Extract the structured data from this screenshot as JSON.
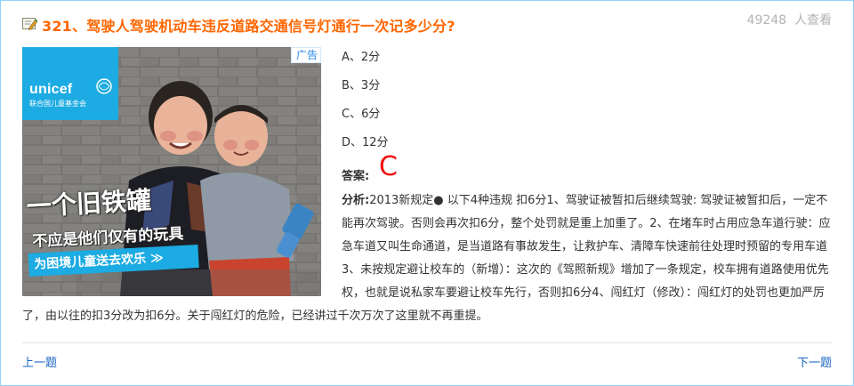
{
  "question": {
    "number_title": "321、驾驶人驾驶机动车违反道路交通信号灯通行一次记多少分?",
    "views_count": "49248",
    "views_suffix": "人查看",
    "icon": "edit-icon"
  },
  "ad": {
    "badge": "广告",
    "brand": "unicef",
    "brand_sub": "联合国儿童基金会",
    "headline": "一个旧铁罐",
    "subline": "不应是他们仅有的玩具",
    "cta": "为困境儿童送去欢乐 ≫"
  },
  "options": [
    {
      "label": "A、2分"
    },
    {
      "label": "B、3分"
    },
    {
      "label": "C、6分"
    },
    {
      "label": "D、12分"
    }
  ],
  "answer": {
    "label": "答案:",
    "value": "C",
    "color": "#ee1111"
  },
  "analysis": {
    "label": "分析:",
    "text": "2013新规定● 以下4种违规 扣6分1、驾驶证被暂扣后继续驾驶: 驾驶证被暂扣后，一定不能再次驾驶。否则会再次扣6分，整个处罚就是重上加重了。2、在堵车时占用应急车道行驶：应急车道又叫生命通道，是当道路有事故发生，让救护车、清障车快速前往处理时预留的专用车道3、未按规定避让校车的（新增）：这次的《驾照新规》增加了一条规定，校车拥有道路使用优先权，也就是说私家车要避让校车先行，否则扣6分4、闯红灯（修改）：闯红灯的处罚也更加严厉了，由以往的扣3分改为扣6分。关于闯红灯的危险，已经讲过千次万次了这里就不再重提。"
  },
  "nav": {
    "prev": "上一题",
    "next": "下一题"
  },
  "colors": {
    "title": "#ff6600",
    "link": "#1a66c2",
    "border": "#8fd3ff",
    "unicef_blue": "#1cabe2"
  }
}
